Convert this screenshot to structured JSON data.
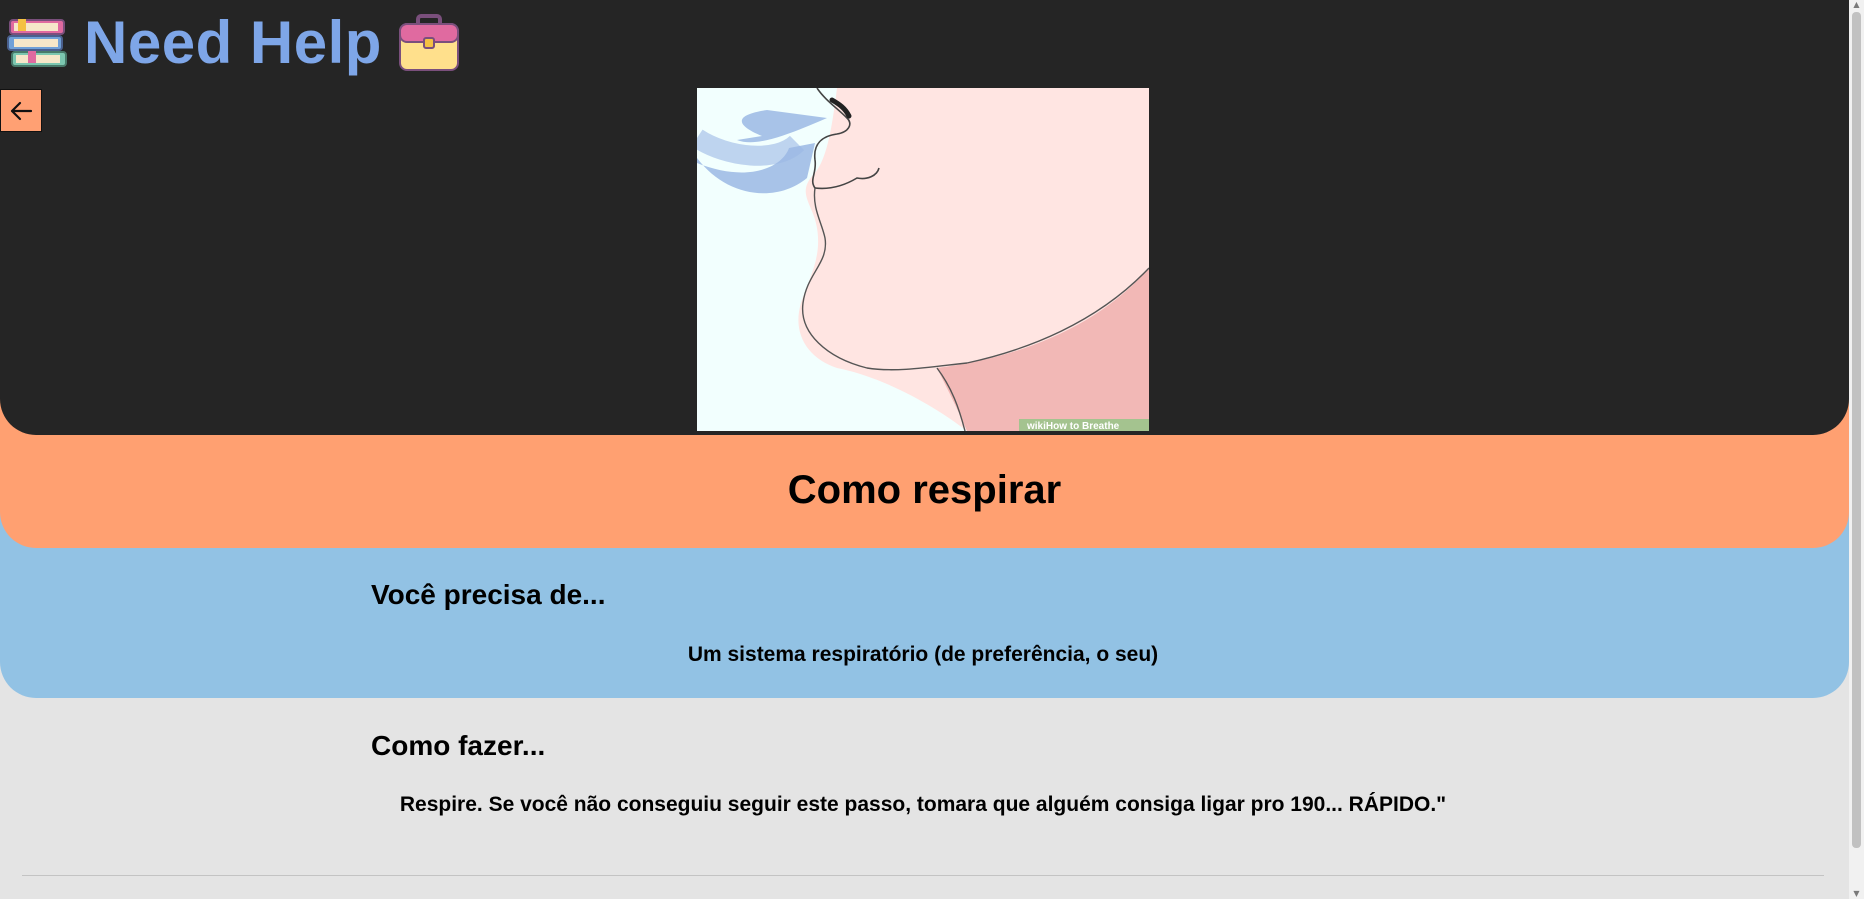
{
  "header": {
    "title": "Need Help",
    "left_icon": "books-icon",
    "right_icon": "toolbox-icon"
  },
  "back_button": {
    "icon": "arrow-left-icon"
  },
  "hero_image": {
    "watermark": "wikiHow to Breathe"
  },
  "page_title": "Como respirar",
  "needs_section": {
    "heading": "Você precisa de...",
    "text": "Um sistema respiratório (de preferência, o seu)"
  },
  "howto_section": {
    "heading": "Como fazer...",
    "text": "Respire. Se você não conseguiu seguir este passo, tomara que alguém consiga ligar pro 190... RÁPIDO.\""
  },
  "colors": {
    "dark_bg": "#252525",
    "accent_orange": "#ffa071",
    "accent_blue": "#92c2e4",
    "title_blue": "#7ea6e8",
    "page_bg": "#e4e4e4"
  }
}
